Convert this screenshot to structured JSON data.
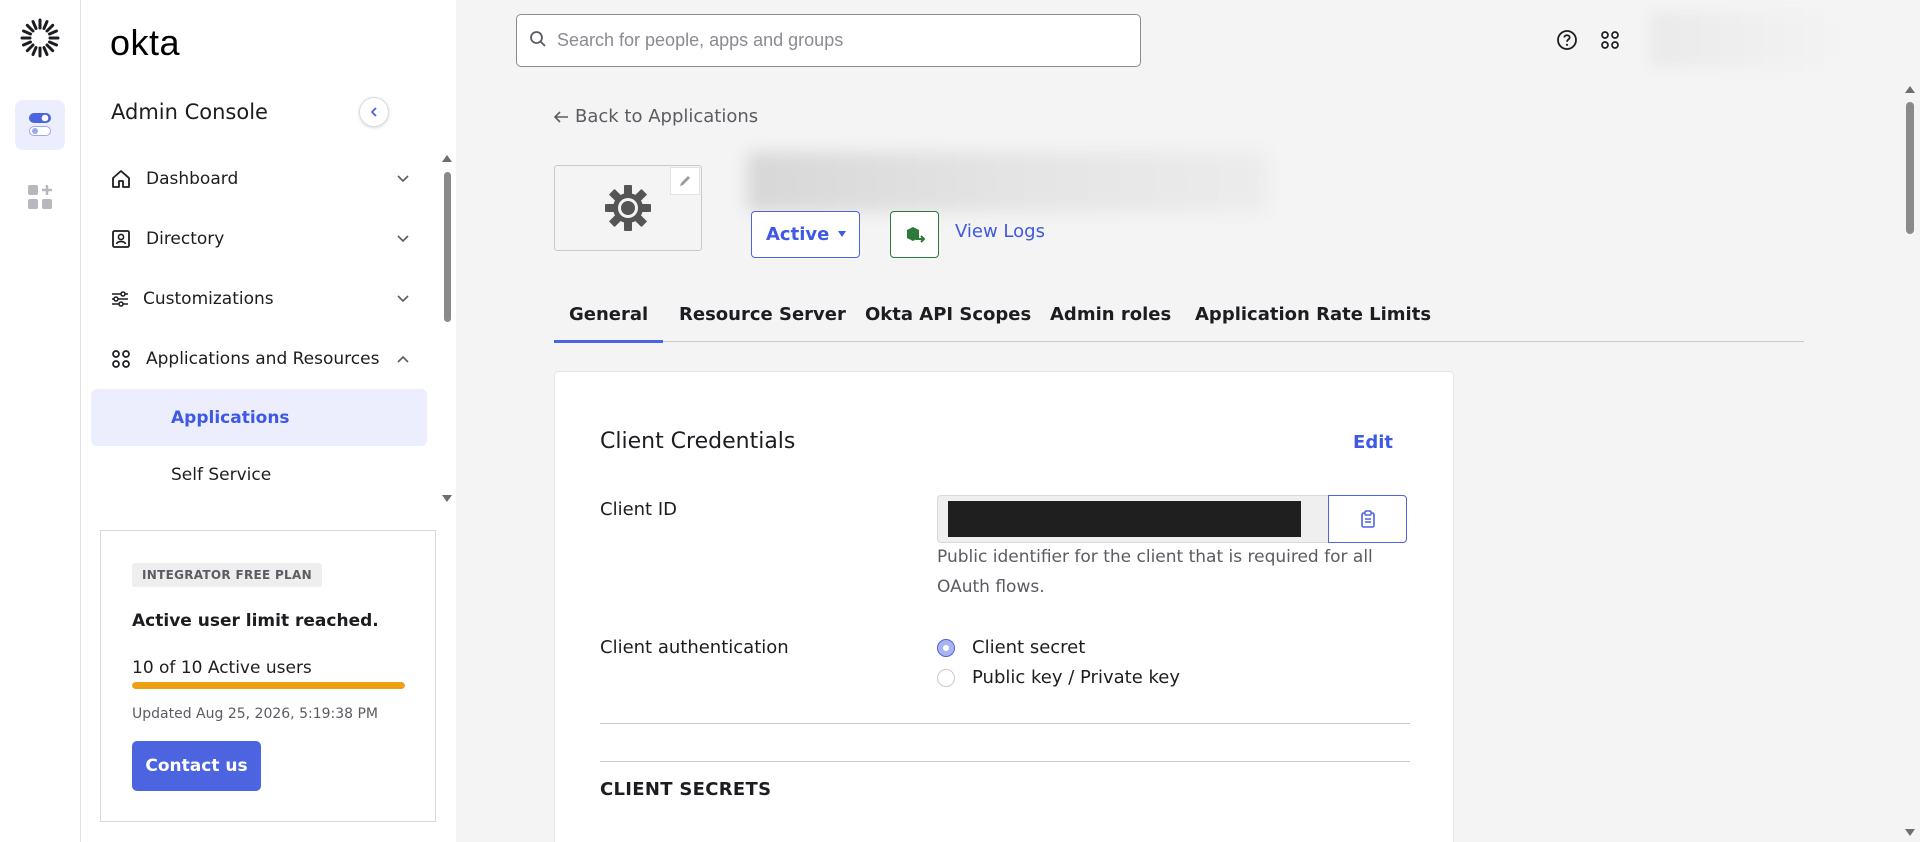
{
  "brand": {
    "logo_text": "okta",
    "accent": "#4c64e0",
    "warning": "#ef9f12"
  },
  "rail": {
    "icons": [
      "okta-burst-icon",
      "admin-toggle-icon",
      "add-apps-icon"
    ]
  },
  "sidebar": {
    "title": "Admin Console",
    "items": [
      {
        "label": "Dashboard",
        "icon": "home-icon",
        "expanded": false
      },
      {
        "label": "Directory",
        "icon": "directory-icon",
        "expanded": false
      },
      {
        "label": "Customizations",
        "icon": "sliders-icon",
        "expanded": false
      },
      {
        "label": "Applications and Resources",
        "icon": "apps-grid-icon",
        "expanded": true
      }
    ],
    "sub_items": [
      {
        "label": "Applications",
        "active": true
      },
      {
        "label": "Self Service",
        "active": false
      }
    ]
  },
  "plan": {
    "badge": "INTEGRATOR FREE PLAN",
    "heading": "Active user limit reached.",
    "users": "10 of 10 Active users",
    "usage_fraction": 1.0,
    "updated": "Updated Aug 25, 2026, 5:19:38 PM",
    "contact_label": "Contact us"
  },
  "header": {
    "search_placeholder": "Search for people, apps and groups"
  },
  "main": {
    "back_label": "Back to Applications",
    "status_label": "Active",
    "view_logs_label": "View Logs",
    "tabs": [
      {
        "label": "General",
        "active": true
      },
      {
        "label": "Resource Server",
        "active": false
      },
      {
        "label": "Okta API Scopes",
        "active": false
      },
      {
        "label": "Admin roles",
        "active": false
      },
      {
        "label": "Application Rate Limits",
        "active": false
      }
    ],
    "card": {
      "title": "Client Credentials",
      "edit_label": "Edit",
      "client_id_label": "Client ID",
      "client_id_help": "Public identifier for the client that is required for all OAuth flows.",
      "auth_label": "Client authentication",
      "auth_options": [
        {
          "label": "Client secret",
          "checked": true
        },
        {
          "label": "Public key / Private key",
          "checked": false
        }
      ],
      "secrets_title": "CLIENT SECRETS"
    }
  }
}
